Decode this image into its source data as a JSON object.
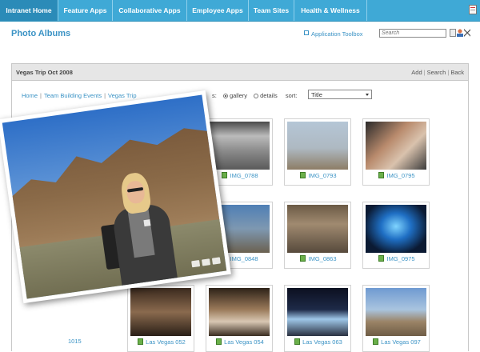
{
  "nav": {
    "tabs": [
      {
        "label": "Intranet Home",
        "active": true
      },
      {
        "label": "Feature Apps",
        "active": false
      },
      {
        "label": "Collaborative Apps",
        "active": false
      },
      {
        "label": "Employee Apps",
        "active": false
      },
      {
        "label": "Team Sites",
        "active": false
      },
      {
        "label": "Health & Wellness",
        "active": false
      }
    ]
  },
  "header": {
    "page_title": "Photo Albums",
    "app_toolbox": "Application Toolbox",
    "search_placeholder": "Search"
  },
  "album": {
    "title": "Vegas Trip Oct 2008",
    "actions": [
      "Add",
      "Search",
      "Back"
    ],
    "breadcrumb": [
      "Home",
      "Team Building Events",
      "Vegas Trip"
    ],
    "view_label": "s:",
    "view_options": [
      {
        "label": "gallery",
        "selected": true
      },
      {
        "label": "details",
        "selected": false
      }
    ],
    "sort_label": "sort:",
    "sort_value": "Title"
  },
  "thumbnails": {
    "row1": [
      "IMG_0788",
      "IMG_0793",
      "IMG_0795"
    ],
    "row2": [
      "IMG_0848",
      "IMG_0863",
      "IMG_0975"
    ],
    "row3": [
      "Las Vegas 052",
      "Las Vegas 054",
      "Las Vegas 063",
      "Las Vegas 097"
    ],
    "partial": "1015"
  },
  "colors": {
    "nav_bg": "#3fa9d6",
    "link": "#3b93c5",
    "panel_header_bg": "#e6e6e6"
  }
}
